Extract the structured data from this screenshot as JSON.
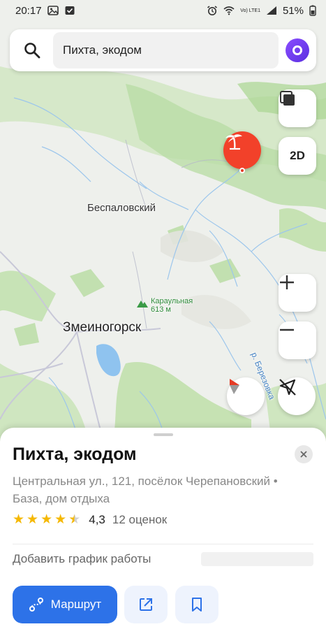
{
  "status": {
    "time": "20:17",
    "signal": "Vo) LTE1",
    "battery": "51%"
  },
  "search": {
    "query": "Пихта, экодом"
  },
  "map": {
    "labels": {
      "village": "Беспаловский",
      "city": "Змеиногорск",
      "peak_name": "Караульная",
      "peak_height": "613 м",
      "river": "р. Березовка"
    },
    "buttons": {
      "view_2d": "2D"
    }
  },
  "place": {
    "title": "Пихта, экодом",
    "address": "Центральная ул., 121, посёлок Черепановский • База, дом отдыха",
    "rating_value": "4,3",
    "rating_stars": 4.3,
    "rating_count": "12 оценок",
    "add_hours": "Добавить график работы",
    "route_label": "Маршрут"
  },
  "colors": {
    "accent": "#2d72e8",
    "pin": "#f2412a",
    "star": "#f5b800"
  }
}
